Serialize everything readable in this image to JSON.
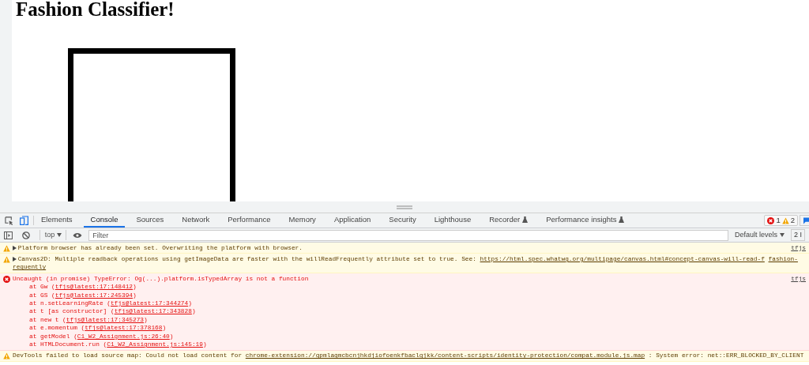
{
  "page": {
    "title": "Fashion Classifier!"
  },
  "devtools": {
    "tabs": [
      {
        "label": "Elements",
        "selected": false,
        "experimental": false
      },
      {
        "label": "Console",
        "selected": true,
        "experimental": false
      },
      {
        "label": "Sources",
        "selected": false,
        "experimental": false
      },
      {
        "label": "Network",
        "selected": false,
        "experimental": false
      },
      {
        "label": "Performance",
        "selected": false,
        "experimental": false
      },
      {
        "label": "Memory",
        "selected": false,
        "experimental": false
      },
      {
        "label": "Application",
        "selected": false,
        "experimental": false
      },
      {
        "label": "Security",
        "selected": false,
        "experimental": false
      },
      {
        "label": "Lighthouse",
        "selected": false,
        "experimental": false
      },
      {
        "label": "Recorder",
        "selected": false,
        "experimental": true
      },
      {
        "label": "Performance insights",
        "selected": false,
        "experimental": true
      }
    ],
    "issue_counts": {
      "errors": "1",
      "warnings": "2"
    },
    "toolbar": {
      "context": "top",
      "filter": {
        "placeholder": "Filter"
      },
      "levels": "Default levels",
      "issues": "2 I"
    },
    "messages": [
      {
        "kind": "warning",
        "expandable": true,
        "source": "tfjs",
        "lines": [
          [
            {
              "kind": "text",
              "text": "Platform browser has already been set. Overwriting the platform with browser."
            }
          ]
        ]
      },
      {
        "kind": "warning",
        "expandable": true,
        "lines": [
          [
            {
              "kind": "text",
              "text": "Canvas2D: Multiple readback operations using getImageData are faster with the willReadFrequently attribute set to true. See:"
            },
            {
              "kind": "link",
              "text": "https://html.spec.whatwg.org/multipage/canvas.html#concept-canvas-will-read-f"
            },
            {
              "kind": "link",
              "text": "fashion-"
            }
          ],
          [
            {
              "kind": "link",
              "text": "requently"
            }
          ]
        ]
      },
      {
        "kind": "error",
        "expandable": false,
        "source": "tfjs",
        "lines": [
          [
            {
              "kind": "text",
              "text": "Uncaught (in promise) TypeError: Og(...).platform.isTypedArray is not a function"
            }
          ]
        ],
        "stack": [
          [
            {
              "kind": "text",
              "text": "at Gw ("
            },
            {
              "kind": "link",
              "text": "tfjs@latest:17:148412"
            },
            {
              "kind": "text",
              "text": ")"
            }
          ],
          [
            {
              "kind": "text",
              "text": "at GS ("
            },
            {
              "kind": "link",
              "text": "tfjs@latest:17:245394"
            },
            {
              "kind": "text",
              "text": ")"
            }
          ],
          [
            {
              "kind": "text",
              "text": "at n.setLearningRate ("
            },
            {
              "kind": "link",
              "text": "tfjs@latest:17:344274"
            },
            {
              "kind": "text",
              "text": ")"
            }
          ],
          [
            {
              "kind": "text",
              "text": "at t [as constructor] ("
            },
            {
              "kind": "link",
              "text": "tfjs@latest:17:343828"
            },
            {
              "kind": "text",
              "text": ")"
            }
          ],
          [
            {
              "kind": "text",
              "text": "at new t ("
            },
            {
              "kind": "link",
              "text": "tfjs@latest:17:345273"
            },
            {
              "kind": "text",
              "text": ")"
            }
          ],
          [
            {
              "kind": "text",
              "text": "at e.momentum ("
            },
            {
              "kind": "link",
              "text": "tfjs@latest:17:378168"
            },
            {
              "kind": "text",
              "text": ")"
            }
          ],
          [
            {
              "kind": "text",
              "text": "at getModel ("
            },
            {
              "kind": "link",
              "text": "C1_W2_Assignment.js:26:40"
            },
            {
              "kind": "text",
              "text": ")"
            }
          ],
          [
            {
              "kind": "text",
              "text": "at HTMLDocument.run ("
            },
            {
              "kind": "link",
              "text": "C1_W2_Assignment.js:145:19"
            },
            {
              "kind": "text",
              "text": ")"
            }
          ]
        ]
      },
      {
        "kind": "warning",
        "expandable": false,
        "lines": [
          [
            {
              "kind": "text",
              "text": "DevTools failed to load source map: Could not load content for"
            },
            {
              "kind": "link",
              "text": "chrome-extension://gpmlagmcbcnjhkdjiofoenkfbaclgjkk/content-scripts/identity-protection/compat.module.js.map"
            },
            {
              "kind": "text",
              "text": ": System error: net::ERR_BLOCKED_BY_CLIENT"
            }
          ]
        ]
      }
    ]
  }
}
